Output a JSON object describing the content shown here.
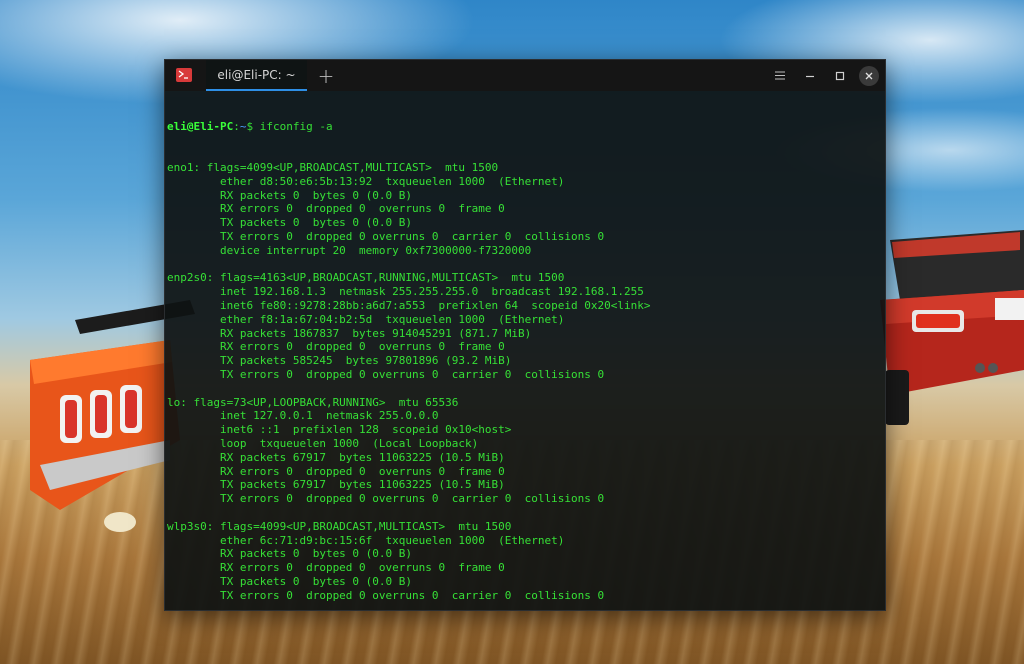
{
  "window": {
    "tab_title": "eli@Eli-PC: ~",
    "new_tab_label": "+"
  },
  "terminal": {
    "prompt_user": "eli@Eli-PC",
    "prompt_sep": ":",
    "prompt_path": "~",
    "prompt_suffix": "$ ",
    "command": "ifconfig -a",
    "output": [
      "eno1: flags=4099<UP,BROADCAST,MULTICAST>  mtu 1500",
      "        ether d8:50:e6:5b:13:92  txqueuelen 1000  (Ethernet)",
      "        RX packets 0  bytes 0 (0.0 B)",
      "        RX errors 0  dropped 0  overruns 0  frame 0",
      "        TX packets 0  bytes 0 (0.0 B)",
      "        TX errors 0  dropped 0 overruns 0  carrier 0  collisions 0",
      "        device interrupt 20  memory 0xf7300000-f7320000",
      "",
      "enp2s0: flags=4163<UP,BROADCAST,RUNNING,MULTICAST>  mtu 1500",
      "        inet 192.168.1.3  netmask 255.255.255.0  broadcast 192.168.1.255",
      "        inet6 fe80::9278:28bb:a6d7:a553  prefixlen 64  scopeid 0x20<link>",
      "        ether f8:1a:67:04:b2:5d  txqueuelen 1000  (Ethernet)",
      "        RX packets 1867837  bytes 914045291 (871.7 MiB)",
      "        RX errors 0  dropped 0  overruns 0  frame 0",
      "        TX packets 585245  bytes 97801896 (93.2 MiB)",
      "        TX errors 0  dropped 0 overruns 0  carrier 0  collisions 0",
      "",
      "lo: flags=73<UP,LOOPBACK,RUNNING>  mtu 65536",
      "        inet 127.0.0.1  netmask 255.0.0.0",
      "        inet6 ::1  prefixlen 128  scopeid 0x10<host>",
      "        loop  txqueuelen 1000  (Local Loopback)",
      "        RX packets 67917  bytes 11063225 (10.5 MiB)",
      "        RX errors 0  dropped 0  overruns 0  frame 0",
      "        TX packets 67917  bytes 11063225 (10.5 MiB)",
      "        TX errors 0  dropped 0 overruns 0  carrier 0  collisions 0",
      "",
      "wlp3s0: flags=4099<UP,BROADCAST,MULTICAST>  mtu 1500",
      "        ether 6c:71:d9:bc:15:6f  txqueuelen 1000  (Ethernet)",
      "        RX packets 0  bytes 0 (0.0 B)",
      "        RX errors 0  dropped 0  overruns 0  frame 0",
      "        TX packets 0  bytes 0 (0.0 B)",
      "        TX errors 0  dropped 0 overruns 0  carrier 0  collisions 0",
      ""
    ]
  },
  "colors": {
    "text": "#36e036",
    "prompt_user": "#3aff3a",
    "prompt_path": "#4ea0ff",
    "tab_accent": "#2e8fe6",
    "app_icon": "#d83a3a"
  },
  "icons": {
    "app": "terminal-icon",
    "menu": "hamburger-menu-icon",
    "minimize": "minimize-icon",
    "maximize": "maximize-icon",
    "close": "close-icon"
  }
}
